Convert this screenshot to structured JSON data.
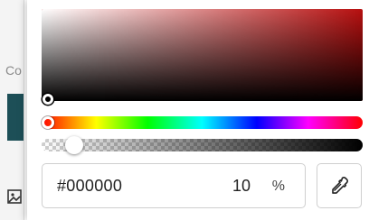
{
  "background": {
    "partial_label": "Co"
  },
  "picker": {
    "base_hue_color": "#b81010",
    "hex_value": "#000000",
    "opacity_value": "10",
    "opacity_unit": "%",
    "opacity_fraction": 0.1,
    "hue_position": 0.0
  },
  "icons": {
    "eyedropper": "eyedropper-icon",
    "image": "image-icon"
  }
}
